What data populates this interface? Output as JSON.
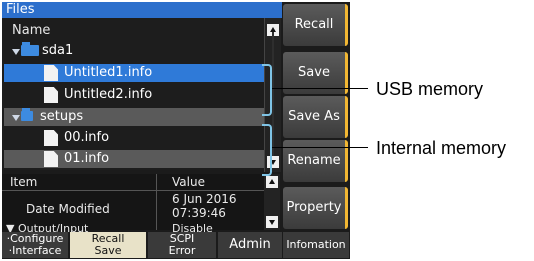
{
  "title": "Files",
  "list_header": "Name",
  "tree": [
    {
      "type": "folder",
      "label": "sda1"
    },
    {
      "type": "file",
      "label": "Untitled1.info",
      "selected": true
    },
    {
      "type": "file",
      "label": "Untitled2.info"
    },
    {
      "type": "folder",
      "label": "setups"
    },
    {
      "type": "file",
      "label": "00.info"
    },
    {
      "type": "file",
      "label": "01.info"
    }
  ],
  "info": {
    "col_item": "Item",
    "col_value": "Value",
    "date_label": "Date Modified",
    "date_value_1": "6 Jun 2016",
    "date_value_2": "07:39:46",
    "output_label": "Output/Input",
    "output_value": "Disable"
  },
  "side_buttons": {
    "recall": "Recall",
    "save": "Save",
    "save_as": "Save As",
    "rename": "Rename",
    "property": "Property"
  },
  "bottom_tabs": {
    "configure_1": "Configure",
    "configure_2": "Interface",
    "recall_1": "Recall",
    "recall_2": "Save",
    "scpi_1": "SCPI",
    "scpi_2": "Error",
    "admin": "Admin",
    "infomation": "Infomation"
  },
  "callouts": {
    "usb": "USB memory",
    "internal": "Internal memory"
  },
  "colors": {
    "title_bar": "#2c6fcc",
    "selected_row": "#2f7ad8",
    "button_accent": "#f2b733",
    "bracket": "#7fc4e6"
  }
}
